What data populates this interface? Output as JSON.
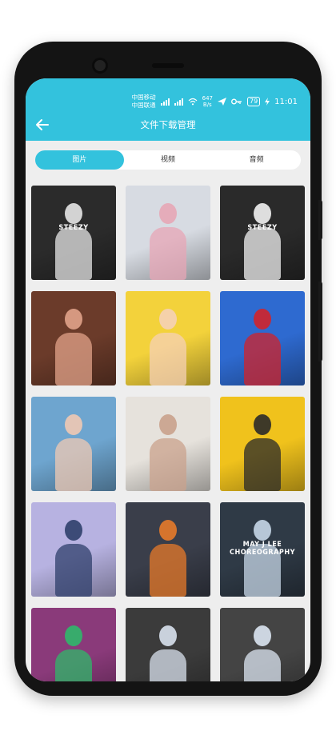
{
  "status_bar": {
    "carrier1": "中国移动",
    "carrier2": "中国联通",
    "net_speed_value": "647",
    "net_speed_unit": "B/s",
    "battery": "79",
    "time": "11:01"
  },
  "header": {
    "title": "文件下载管理"
  },
  "tabs": [
    {
      "label": "图片",
      "active": true
    },
    {
      "label": "视频",
      "active": false
    },
    {
      "label": "音频",
      "active": false
    }
  ],
  "images": [
    {
      "bg": "#2b2b2b",
      "accent": "#e6e6e6",
      "text": "STEEZY"
    },
    {
      "bg": "#d7dbe2",
      "accent": "#e7a6b6",
      "text": ""
    },
    {
      "bg": "#2a2a2a",
      "accent": "#f2f2f2",
      "text": "STEEZY"
    },
    {
      "bg": "#6b3b2a",
      "accent": "#e1a38a",
      "text": ""
    },
    {
      "bg": "#f3d23b",
      "accent": "#f5d0b7",
      "text": ""
    },
    {
      "bg": "#2e6ad0",
      "accent": "#d2232a",
      "text": ""
    },
    {
      "bg": "#6ea5cf",
      "accent": "#f0c9b3",
      "text": ""
    },
    {
      "bg": "#e6e2dc",
      "accent": "#c9a28c",
      "text": ""
    },
    {
      "bg": "#f0c21c",
      "accent": "#2a2a2a",
      "text": ""
    },
    {
      "bg": "#b7b2e1",
      "accent": "#2f3f6b",
      "text": ""
    },
    {
      "bg": "#3a3e4a",
      "accent": "#e77a2a",
      "text": ""
    },
    {
      "bg": "#2f3a46",
      "accent": "#c7d7e7",
      "text": "MAY J LEE CHOREOGRAPHY"
    },
    {
      "bg": "#8a3a7a",
      "accent": "#2fb86a",
      "text": ""
    },
    {
      "bg": "#3b3b3b",
      "accent": "#d9e2ee",
      "text": ""
    },
    {
      "bg": "#444444",
      "accent": "#dce6f2",
      "text": ""
    }
  ]
}
